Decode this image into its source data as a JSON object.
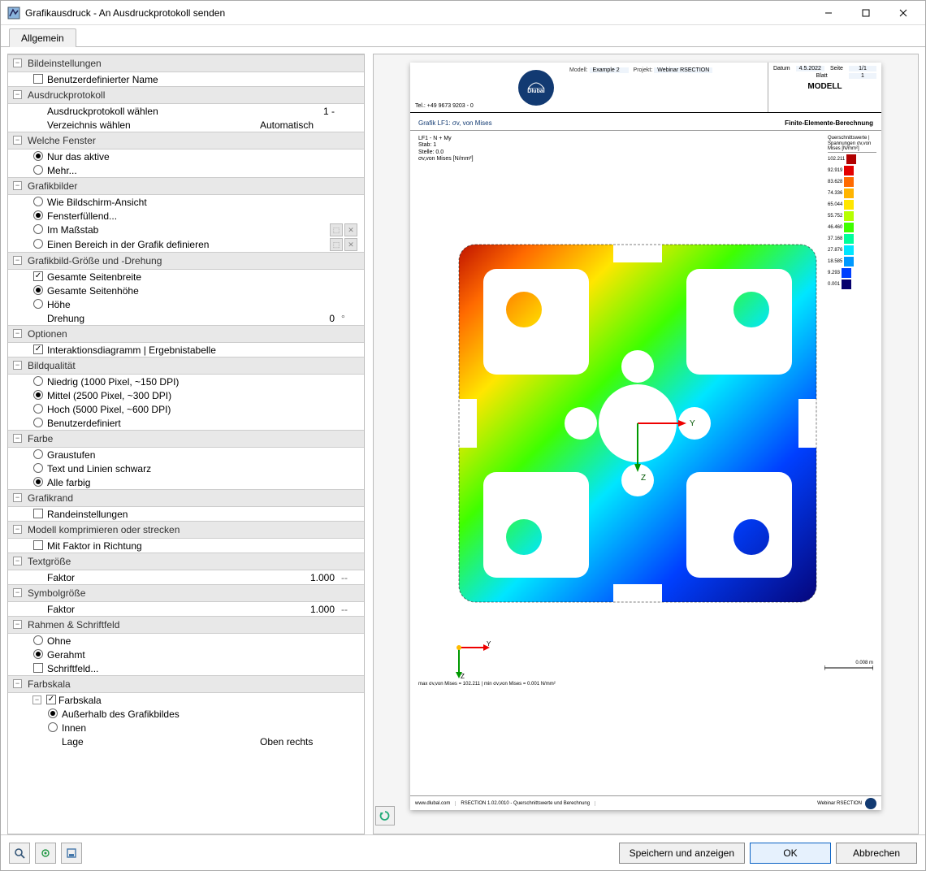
{
  "window": {
    "title": "Grafikausdruck - An Ausdruckprotokoll senden"
  },
  "tab": "Allgemein",
  "sections": {
    "bild": {
      "title": "Bildeinstellungen",
      "custom_name": "Benutzerdefinierter Name"
    },
    "ausdruck": {
      "title": "Ausdruckprotokoll",
      "select": "Ausdruckprotokoll wählen",
      "select_val": "1 -",
      "dir": "Verzeichnis wählen",
      "dir_val": "Automatisch"
    },
    "fenster": {
      "title": "Welche Fenster",
      "active": "Nur das aktive",
      "more": "Mehr..."
    },
    "grafikbilder": {
      "title": "Grafikbilder",
      "screen": "Wie Bildschirm-Ansicht",
      "fill": "Fensterfüllend...",
      "scale": "Im Maßstab",
      "region": "Einen Bereich in der Grafik definieren"
    },
    "size": {
      "title": "Grafikbild-Größe und -Drehung",
      "fullw": "Gesamte Seitenbreite",
      "fullh": "Gesamte Seitenhöhe",
      "height": "Höhe",
      "rot": "Drehung",
      "rot_val": "0",
      "rot_unit": "°"
    },
    "options": {
      "title": "Optionen",
      "diagram": "Interaktionsdiagramm | Ergebnistabelle"
    },
    "qual": {
      "title": "Bildqualität",
      "low": "Niedrig (1000 Pixel, ~150 DPI)",
      "mid": "Mittel (2500 Pixel, ~300 DPI)",
      "high": "Hoch (5000 Pixel, ~600 DPI)",
      "custom": "Benutzerdefiniert"
    },
    "color": {
      "title": "Farbe",
      "gray": "Graustufen",
      "bw": "Text und Linien schwarz",
      "all": "Alle farbig"
    },
    "border": {
      "title": "Grafikrand",
      "opt": "Randeinstellungen"
    },
    "compress": {
      "title": "Modell komprimieren oder strecken",
      "opt": "Mit Faktor in Richtung"
    },
    "text": {
      "title": "Textgröße",
      "factor": "Faktor",
      "val": "1.000",
      "unit": "--"
    },
    "symbol": {
      "title": "Symbolgröße",
      "factor": "Faktor",
      "val": "1.000",
      "unit": "--"
    },
    "frame": {
      "title": "Rahmen & Schriftfeld",
      "none": "Ohne",
      "framed": "Gerahmt",
      "block": "Schriftfeld..."
    },
    "scale": {
      "title": "Farbskala",
      "cb": "Farbskala",
      "outside": "Außerhalb des Grafikbildes",
      "inside": "Innen",
      "pos": "Lage",
      "pos_val": "Oben rechts"
    }
  },
  "preview": {
    "tel": "Tel.: +49 9673 9203 - 0",
    "logo": "Dlubal",
    "model_k": "Modell:",
    "model_v": "Example 2",
    "project_k": "Projekt:",
    "project_v": "Webinar RSECTION",
    "date_k": "Datum",
    "date_v": "4.5.2022",
    "page_k": "Seite",
    "page_v": "1/1",
    "sheet_k": "Blatt",
    "sheet_v": "1",
    "modell": "MODELL",
    "sub_l": "Grafik   LF1: σv, von Mises",
    "sub_r": "Finite-Elemente-Berechnung",
    "annot": [
      "LF1 - N + My",
      "Stab: 1",
      "Stelle: 0.0",
      "σv,von Mises [N/mm²]"
    ],
    "legend_title": "Querschnittswerte | Spannungen σv,von Mises [N/mm²]",
    "legend": [
      {
        "v": "102.211",
        "c": "#b10000"
      },
      {
        "v": "92.919",
        "c": "#e30000"
      },
      {
        "v": "83.628",
        "c": "#ff6a00"
      },
      {
        "v": "74.336",
        "c": "#ffb400"
      },
      {
        "v": "65.044",
        "c": "#ffe600"
      },
      {
        "v": "55.752",
        "c": "#b6ff00"
      },
      {
        "v": "46.460",
        "c": "#3fff00"
      },
      {
        "v": "37.168",
        "c": "#00ff9c"
      },
      {
        "v": "27.876",
        "c": "#00e6ff"
      },
      {
        "v": "18.585",
        "c": "#0099ff"
      },
      {
        "v": "9.293",
        "c": "#0040ff"
      },
      {
        "v": "0.001",
        "c": "#06006e"
      }
    ],
    "scalebar": "0.008 m",
    "footline": "max σv,von Mises = 102.211 | min σv,von Mises = 0.001 N/mm²",
    "ftr_site": "www.dlubal.com",
    "ftr_app": "RSECTION 1.02.0010 - Querschnittswerte und Berechnung",
    "ftr_proj": "Webinar RSECTION"
  },
  "buttons": {
    "save": "Speichern und anzeigen",
    "ok": "OK",
    "cancel": "Abbrechen"
  }
}
